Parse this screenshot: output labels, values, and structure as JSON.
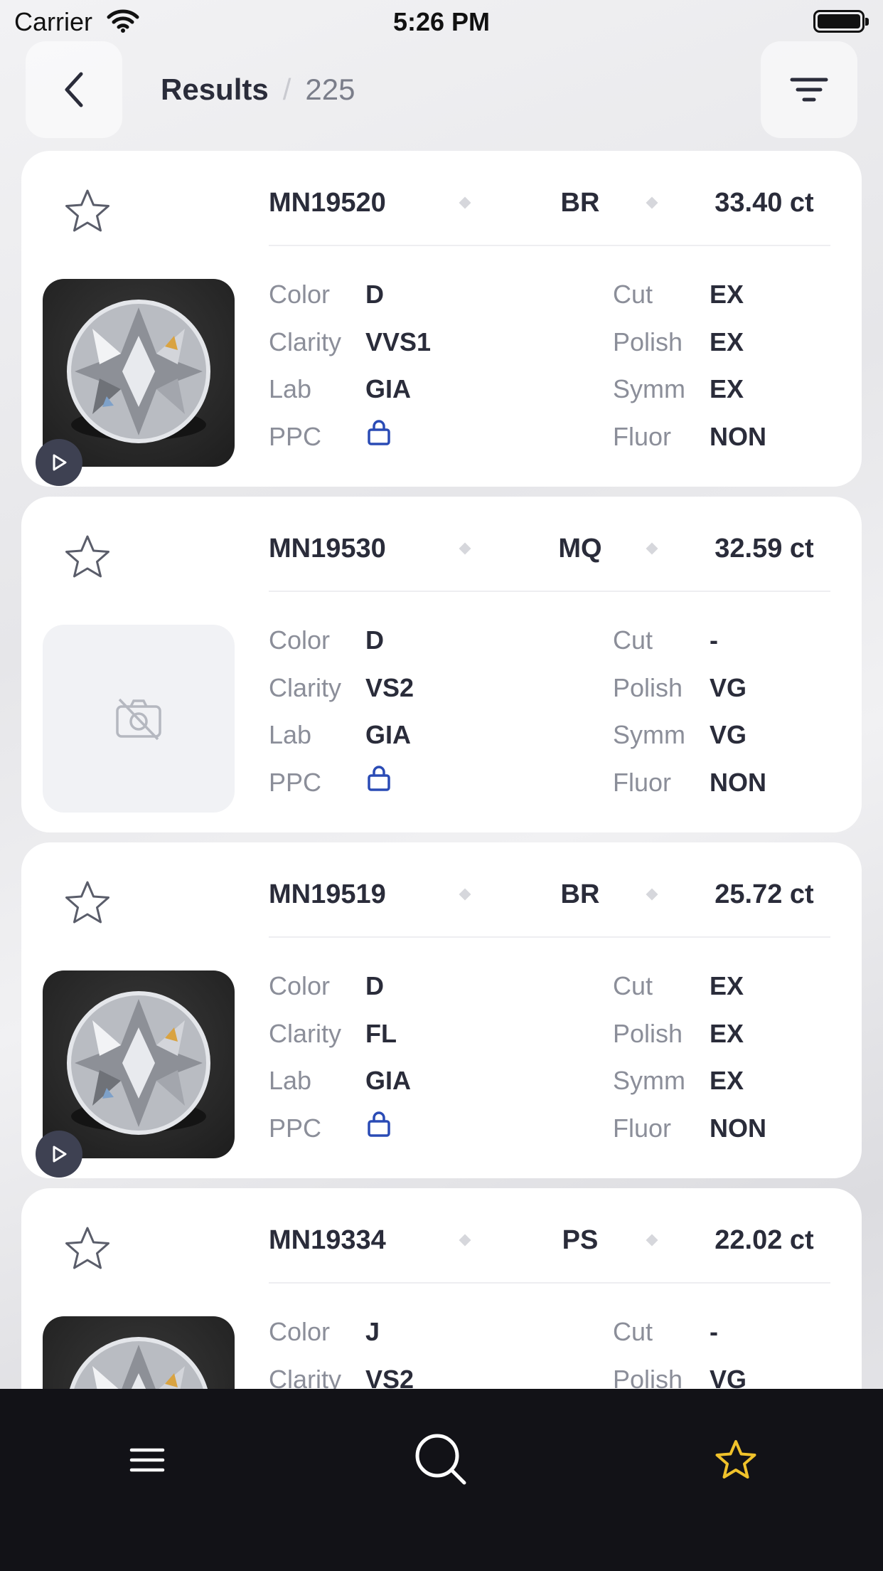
{
  "status_bar": {
    "carrier": "Carrier",
    "time": "5:26 PM"
  },
  "header": {
    "title": "Results",
    "separator": "/",
    "count": "225"
  },
  "labels": {
    "color": "Color",
    "clarity": "Clarity",
    "lab": "Lab",
    "ppc": "PPC",
    "cut": "Cut",
    "polish": "Polish",
    "symm": "Symm",
    "fluor": "Fluor"
  },
  "icons": {
    "back": "chevron-left-icon",
    "filter": "filter-icon",
    "favorite": "star-outline-icon",
    "ppc": "lock-icon",
    "play": "play-icon",
    "no_image": "no-camera-icon",
    "tab_menu": "menu-icon",
    "tab_search": "search-icon",
    "tab_favorites": "star-icon"
  },
  "colors": {
    "accent_blue": "#2a4bb5",
    "tab_active": "#f0c22b",
    "tabbar_bg": "#121217"
  },
  "items": [
    {
      "code": "MN19520",
      "shape": "BR",
      "carat": "33.40 ct",
      "color": "D",
      "clarity": "VVS1",
      "lab": "GIA",
      "cut": "EX",
      "polish": "EX",
      "symm": "EX",
      "fluor": "NON",
      "has_image": true,
      "has_video": true
    },
    {
      "code": "MN19530",
      "shape": "MQ",
      "carat": "32.59 ct",
      "color": "D",
      "clarity": "VS2",
      "lab": "GIA",
      "cut": "-",
      "polish": "VG",
      "symm": "VG",
      "fluor": "NON",
      "has_image": false,
      "has_video": false
    },
    {
      "code": "MN19519",
      "shape": "BR",
      "carat": "25.72 ct",
      "color": "D",
      "clarity": "FL",
      "lab": "GIA",
      "cut": "EX",
      "polish": "EX",
      "symm": "EX",
      "fluor": "NON",
      "has_image": true,
      "has_video": true
    },
    {
      "code": "MN19334",
      "shape": "PS",
      "carat": "22.02 ct",
      "color": "J",
      "clarity": "VS2",
      "lab": "",
      "cut": "-",
      "polish": "VG",
      "symm": "",
      "fluor": "",
      "has_image": true,
      "has_video": false
    }
  ]
}
